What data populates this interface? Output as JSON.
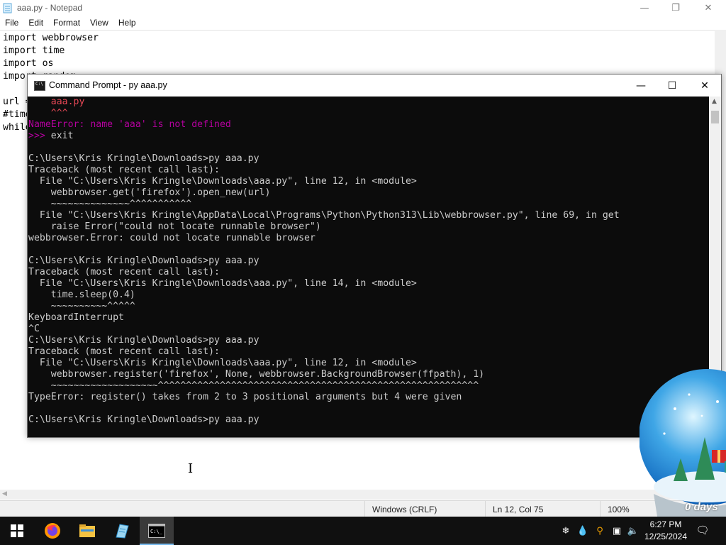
{
  "notepad": {
    "title": "aaa.py - Notepad",
    "menu": [
      "File",
      "Edit",
      "Format",
      "View",
      "Help"
    ],
    "lines": [
      "import webbrowser",
      "import time",
      "import os",
      "import random",
      "",
      "url =",
      "#time",
      "while"
    ],
    "status": {
      "encoding": "Windows (CRLF)",
      "position": "Ln 12, Col 75",
      "zoom": "100%"
    }
  },
  "cmd": {
    "title": "Command Prompt - py  aaa.py",
    "lines": [
      {
        "text": "    aaa.py",
        "style": "red-name"
      },
      {
        "text": "    ^^^",
        "style": "red"
      },
      {
        "text": "NameError: name 'aaa' is not defined",
        "style": "magenta-error"
      },
      {
        "text": ">>> exit",
        "style": "prompt"
      },
      {
        "text": "",
        "style": "normal"
      },
      {
        "text": "C:\\Users\\Kris Kringle\\Downloads>py aaa.py",
        "style": "normal"
      },
      {
        "text": "Traceback (most recent call last):",
        "style": "normal"
      },
      {
        "text": "  File \"C:\\Users\\Kris Kringle\\Downloads\\aaa.py\", line 12, in <module>",
        "style": "normal"
      },
      {
        "text": "    webbrowser.get('firefox').open_new(url)",
        "style": "normal"
      },
      {
        "text": "    ~~~~~~~~~~~~~~^^^^^^^^^^^",
        "style": "normal"
      },
      {
        "text": "  File \"C:\\Users\\Kris Kringle\\AppData\\Local\\Programs\\Python\\Python313\\Lib\\webbrowser.py\", line 69, in get",
        "style": "normal"
      },
      {
        "text": "    raise Error(\"could not locate runnable browser\")",
        "style": "normal"
      },
      {
        "text": "webbrowser.Error: could not locate runnable browser",
        "style": "normal"
      },
      {
        "text": "",
        "style": "normal"
      },
      {
        "text": "C:\\Users\\Kris Kringle\\Downloads>py aaa.py",
        "style": "normal"
      },
      {
        "text": "Traceback (most recent call last):",
        "style": "normal"
      },
      {
        "text": "  File \"C:\\Users\\Kris Kringle\\Downloads\\aaa.py\", line 14, in <module>",
        "style": "normal"
      },
      {
        "text": "    time.sleep(0.4)",
        "style": "normal"
      },
      {
        "text": "    ~~~~~~~~~~^^^^^",
        "style": "normal"
      },
      {
        "text": "KeyboardInterrupt",
        "style": "normal"
      },
      {
        "text": "^C",
        "style": "normal"
      },
      {
        "text": "C:\\Users\\Kris Kringle\\Downloads>py aaa.py",
        "style": "normal"
      },
      {
        "text": "Traceback (most recent call last):",
        "style": "normal"
      },
      {
        "text": "  File \"C:\\Users\\Kris Kringle\\Downloads\\aaa.py\", line 12, in <module>",
        "style": "normal"
      },
      {
        "text": "    webbrowser.register('firefox', None, webbrowser.BackgroundBrowser(ffpath), 1)",
        "style": "normal"
      },
      {
        "text": "    ~~~~~~~~~~~~~~~~~~~^^^^^^^^^^^^^^^^^^^^^^^^^^^^^^^^^^^^^^^^^^^^^^^^^^^^^^^^^",
        "style": "normal"
      },
      {
        "text": "TypeError: register() takes from 2 to 3 positional arguments but 4 were given",
        "style": "normal"
      },
      {
        "text": "",
        "style": "normal"
      },
      {
        "text": "C:\\Users\\Kris Kringle\\Downloads>py aaa.py",
        "style": "normal"
      }
    ]
  },
  "snowglobe": {
    "label": "0 days"
  },
  "taskbar": {
    "apps": [
      "start-icon",
      "firefox-icon",
      "file-explorer-icon",
      "notepad-icon",
      "command-prompt-icon"
    ],
    "tray": [
      "people-icon",
      "water-drop-icon",
      "search-icon",
      "network-icon",
      "volume-icon"
    ],
    "time": "6:27 PM",
    "date": "12/25/2024"
  },
  "colors": {
    "cmd_background": "#0c0c0c",
    "cmd_text": "#cccccc",
    "error_red": "#e74856",
    "error_magenta": "#b4009e",
    "taskbar": "#101010",
    "accent": "#76b9ed"
  }
}
